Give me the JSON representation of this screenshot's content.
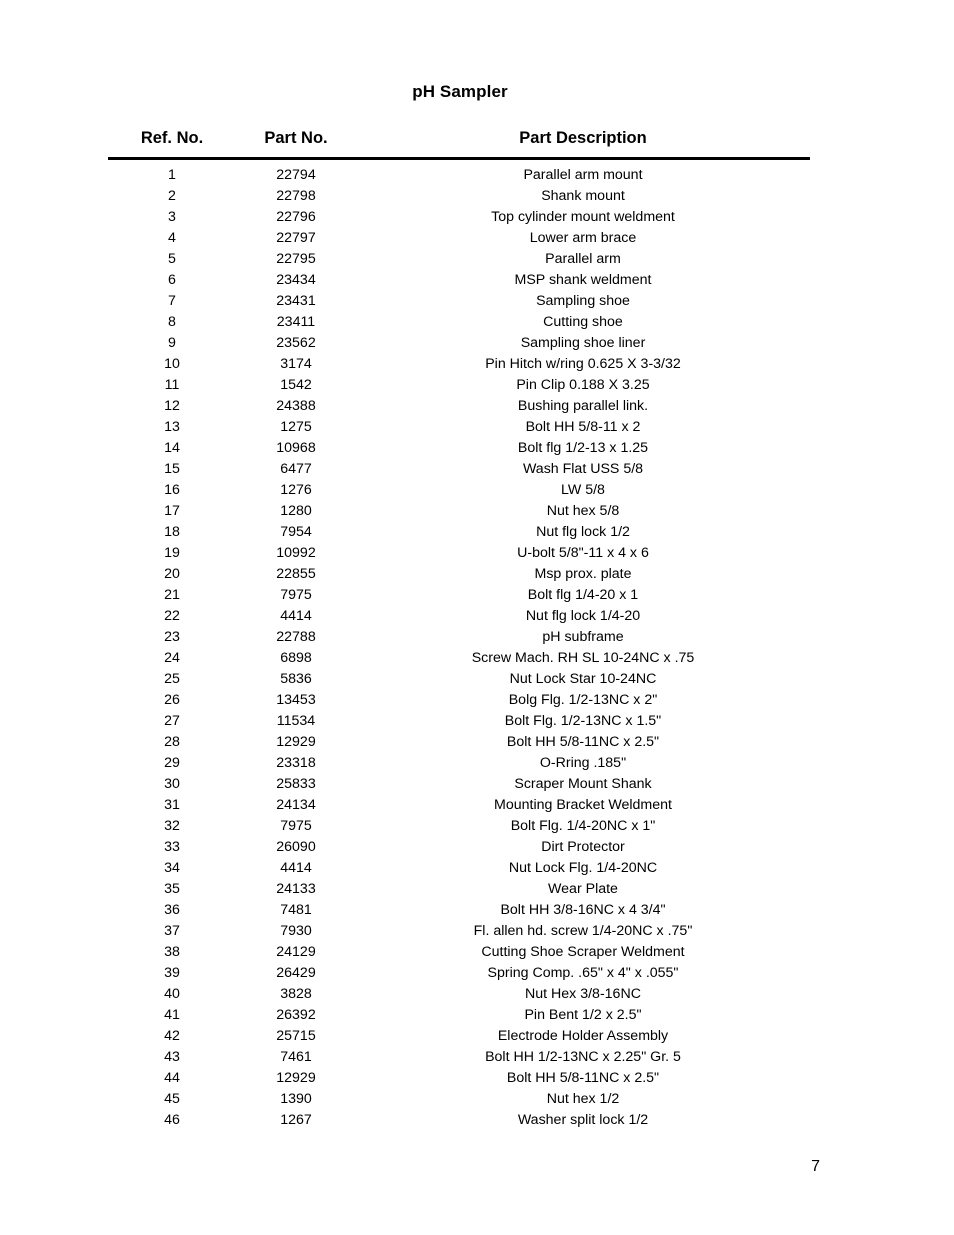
{
  "document": {
    "title": "pH Sampler",
    "page_number": "7"
  },
  "table": {
    "columns": [
      {
        "key": "ref",
        "label": "Ref. No."
      },
      {
        "key": "part",
        "label": "Part No."
      },
      {
        "key": "desc",
        "label": "Part Description"
      }
    ],
    "rows": [
      {
        "ref": "1",
        "part": "22794",
        "desc": "Parallel arm mount"
      },
      {
        "ref": "2",
        "part": "22798",
        "desc": "Shank mount"
      },
      {
        "ref": "3",
        "part": "22796",
        "desc": "Top cylinder mount weldment"
      },
      {
        "ref": "4",
        "part": "22797",
        "desc": "Lower arm brace"
      },
      {
        "ref": "5",
        "part": "22795",
        "desc": "Parallel arm"
      },
      {
        "ref": "6",
        "part": "23434",
        "desc": "MSP shank weldment"
      },
      {
        "ref": "7",
        "part": "23431",
        "desc": "Sampling shoe"
      },
      {
        "ref": "8",
        "part": "23411",
        "desc": "Cutting shoe"
      },
      {
        "ref": "9",
        "part": "23562",
        "desc": "Sampling shoe liner"
      },
      {
        "ref": "10",
        "part": "3174",
        "desc": "Pin Hitch w/ring 0.625 X 3-3/32"
      },
      {
        "ref": "11",
        "part": "1542",
        "desc": "Pin Clip 0.188 X 3.25"
      },
      {
        "ref": "12",
        "part": "24388",
        "desc": "Bushing parallel link."
      },
      {
        "ref": "13",
        "part": "1275",
        "desc": "Bolt HH 5/8-11 x 2"
      },
      {
        "ref": "14",
        "part": "10968",
        "desc": "Bolt flg 1/2-13 x 1.25"
      },
      {
        "ref": "15",
        "part": "6477",
        "desc": "Wash Flat USS 5/8"
      },
      {
        "ref": "16",
        "part": "1276",
        "desc": "LW 5/8"
      },
      {
        "ref": "17",
        "part": "1280",
        "desc": "Nut hex 5/8"
      },
      {
        "ref": "18",
        "part": "7954",
        "desc": "Nut flg lock 1/2"
      },
      {
        "ref": "19",
        "part": "10992",
        "desc": "U-bolt 5/8\"-11 x 4 x 6"
      },
      {
        "ref": "20",
        "part": "22855",
        "desc": "Msp prox. plate"
      },
      {
        "ref": "21",
        "part": "7975",
        "desc": "Bolt flg 1/4-20 x 1"
      },
      {
        "ref": "22",
        "part": "4414",
        "desc": "Nut flg lock 1/4-20"
      },
      {
        "ref": "23",
        "part": "22788",
        "desc": "pH subframe"
      },
      {
        "ref": "24",
        "part": "6898",
        "desc": "Screw Mach. RH SL 10-24NC x .75"
      },
      {
        "ref": "25",
        "part": "5836",
        "desc": "Nut Lock Star 10-24NC"
      },
      {
        "ref": "26",
        "part": "13453",
        "desc": "Bolg Flg. 1/2-13NC x 2\""
      },
      {
        "ref": "27",
        "part": "11534",
        "desc": "Bolt Flg. 1/2-13NC x 1.5\""
      },
      {
        "ref": "28",
        "part": "12929",
        "desc": "Bolt HH 5/8-11NC x 2.5\""
      },
      {
        "ref": "29",
        "part": "23318",
        "desc": "O-Rring .185\""
      },
      {
        "ref": "30",
        "part": "25833",
        "desc": "Scraper Mount Shank"
      },
      {
        "ref": "31",
        "part": "24134",
        "desc": "Mounting Bracket Weldment"
      },
      {
        "ref": "32",
        "part": "7975",
        "desc": "Bolt Flg. 1/4-20NC x 1\""
      },
      {
        "ref": "33",
        "part": "26090",
        "desc": "Dirt Protector"
      },
      {
        "ref": "34",
        "part": "4414",
        "desc": "Nut Lock Flg. 1/4-20NC"
      },
      {
        "ref": "35",
        "part": "24133",
        "desc": "Wear Plate"
      },
      {
        "ref": "36",
        "part": "7481",
        "desc": "Bolt HH 3/8-16NC x 4 3/4\""
      },
      {
        "ref": "37",
        "part": "7930",
        "desc": "Fl. allen hd. screw 1/4-20NC x .75\""
      },
      {
        "ref": "38",
        "part": "24129",
        "desc": "Cutting Shoe Scraper Weldment"
      },
      {
        "ref": "39",
        "part": "26429",
        "desc": "Spring Comp. .65\" x 4\" x .055\""
      },
      {
        "ref": "40",
        "part": "3828",
        "desc": "Nut Hex 3/8-16NC"
      },
      {
        "ref": "41",
        "part": "26392",
        "desc": "Pin Bent 1/2 x 2.5\""
      },
      {
        "ref": "42",
        "part": "25715",
        "desc": "Electrode Holder Assembly"
      },
      {
        "ref": "43",
        "part": "7461",
        "desc": "Bolt HH 1/2-13NC x 2.25\" Gr. 5"
      },
      {
        "ref": "44",
        "part": "12929",
        "desc": "Bolt HH 5/8-11NC x 2.5\""
      },
      {
        "ref": "45",
        "part": "1390",
        "desc": "Nut hex 1/2"
      },
      {
        "ref": "46",
        "part": "1267",
        "desc": "Washer split lock 1/2"
      }
    ]
  }
}
